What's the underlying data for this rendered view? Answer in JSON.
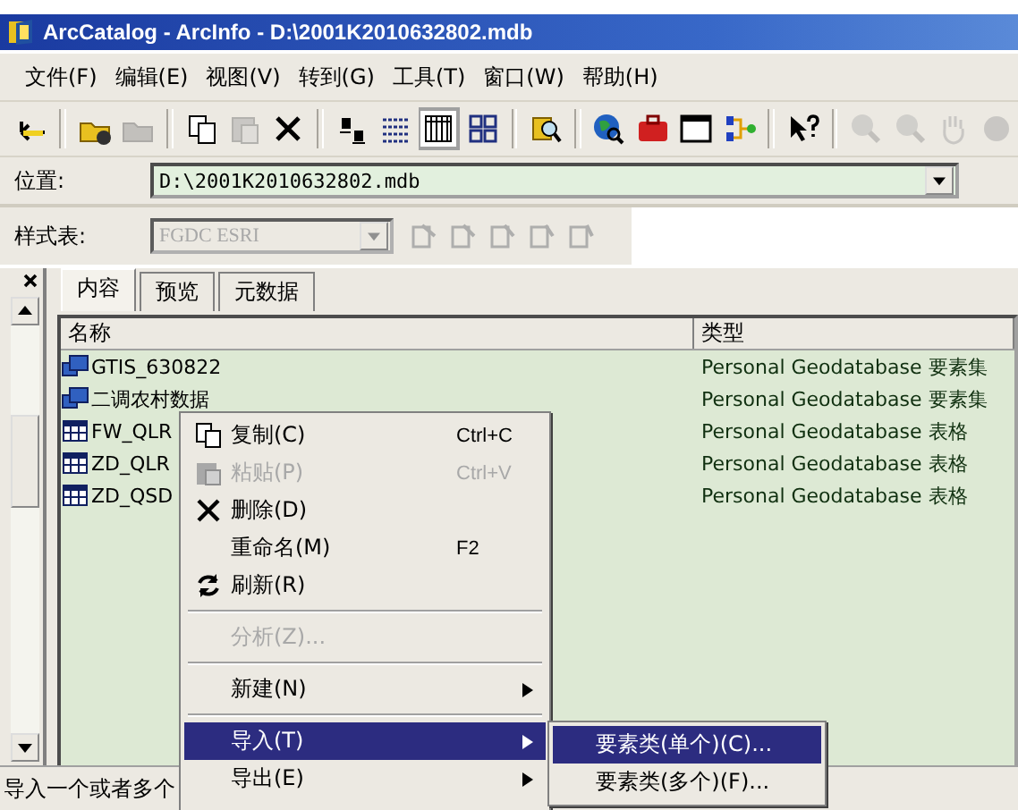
{
  "window": {
    "title": "ArcCatalog - ArcInfo - D:\\2001K2010632802.mdb"
  },
  "menu": [
    "文件(F)",
    "编辑(E)",
    "视图(V)",
    "转到(G)",
    "工具(T)",
    "窗口(W)",
    "帮助(H)"
  ],
  "toolbar": [
    {
      "disabled": false,
      "selected": false
    },
    {
      "disabled": false,
      "selected": false
    },
    {
      "disabled": true,
      "selected": false
    },
    {
      "disabled": false,
      "selected": false
    },
    {
      "disabled": true,
      "selected": false
    },
    {
      "disabled": false,
      "selected": false
    },
    {
      "disabled": false,
      "selected": false
    },
    {
      "disabled": false,
      "selected": false
    },
    {
      "disabled": false,
      "selected": true
    },
    {
      "disabled": false,
      "selected": false
    },
    {
      "disabled": false,
      "selected": false
    },
    {
      "disabled": false,
      "selected": false
    },
    {
      "disabled": false,
      "selected": false
    },
    {
      "disabled": false,
      "selected": false
    },
    {
      "disabled": false,
      "selected": false
    },
    {
      "disabled": false,
      "selected": false
    },
    {
      "disabled": true,
      "selected": false
    },
    {
      "disabled": true,
      "selected": false
    },
    {
      "disabled": true,
      "selected": false
    },
    {
      "disabled": true,
      "selected": false
    }
  ],
  "location": {
    "label": "位置:",
    "value": "D:\\2001K2010632802.mdb"
  },
  "stylesheet": {
    "label": "样式表:",
    "value": "FGDC ESRI",
    "disabled": true
  },
  "tabs": [
    {
      "label": "内容",
      "selected": true
    },
    {
      "label": "预览",
      "selected": false
    },
    {
      "label": "元数据",
      "selected": false
    }
  ],
  "table": {
    "columns": [
      "名称",
      "类型"
    ],
    "rows": [
      {
        "kind": "dataset",
        "name": "GTIS_630822",
        "type": "Personal Geodatabase 要素集"
      },
      {
        "kind": "dataset",
        "name": "二调农村数据",
        "type": "Personal Geodatabase 要素集"
      },
      {
        "kind": "table",
        "name": "FW_QLR",
        "type": "Personal Geodatabase 表格"
      },
      {
        "kind": "table",
        "name": "ZD_QLR",
        "type": "Personal Geodatabase 表格"
      },
      {
        "kind": "table",
        "name": "ZD_QSD",
        "type": "Personal Geodatabase 表格"
      }
    ]
  },
  "context_menu": [
    {
      "kind": "item",
      "label": "复制(C)",
      "shortcut": "Ctrl+C",
      "disabled": false,
      "submenu": false,
      "selected": false
    },
    {
      "kind": "item",
      "label": "粘贴(P)",
      "shortcut": "Ctrl+V",
      "disabled": true,
      "submenu": false,
      "selected": false
    },
    {
      "kind": "item",
      "label": "删除(D)",
      "disabled": false,
      "submenu": false,
      "selected": false
    },
    {
      "kind": "item",
      "label": "重命名(M)",
      "shortcut": "F2",
      "disabled": false,
      "submenu": false,
      "selected": false
    },
    {
      "kind": "item",
      "label": "刷新(R)",
      "disabled": false,
      "submenu": false,
      "selected": false
    },
    {
      "kind": "separator"
    },
    {
      "kind": "item",
      "label": "分析(Z)...",
      "disabled": true,
      "submenu": false,
      "selected": false
    },
    {
      "kind": "separator"
    },
    {
      "kind": "item",
      "label": "新建(N)",
      "disabled": false,
      "submenu": true,
      "selected": false
    },
    {
      "kind": "separator"
    },
    {
      "kind": "item",
      "label": "导入(T)",
      "disabled": false,
      "submenu": true,
      "selected": true
    },
    {
      "kind": "item",
      "label": "导出(E)",
      "disabled": false,
      "submenu": true,
      "selected": false
    }
  ],
  "submenu": [
    {
      "label": "要素类(单个)(C)...",
      "selected": true
    },
    {
      "label": "要素类(多个)(F)...",
      "selected": false
    }
  ],
  "status_bar": {
    "text": "导入一个或者多个"
  }
}
